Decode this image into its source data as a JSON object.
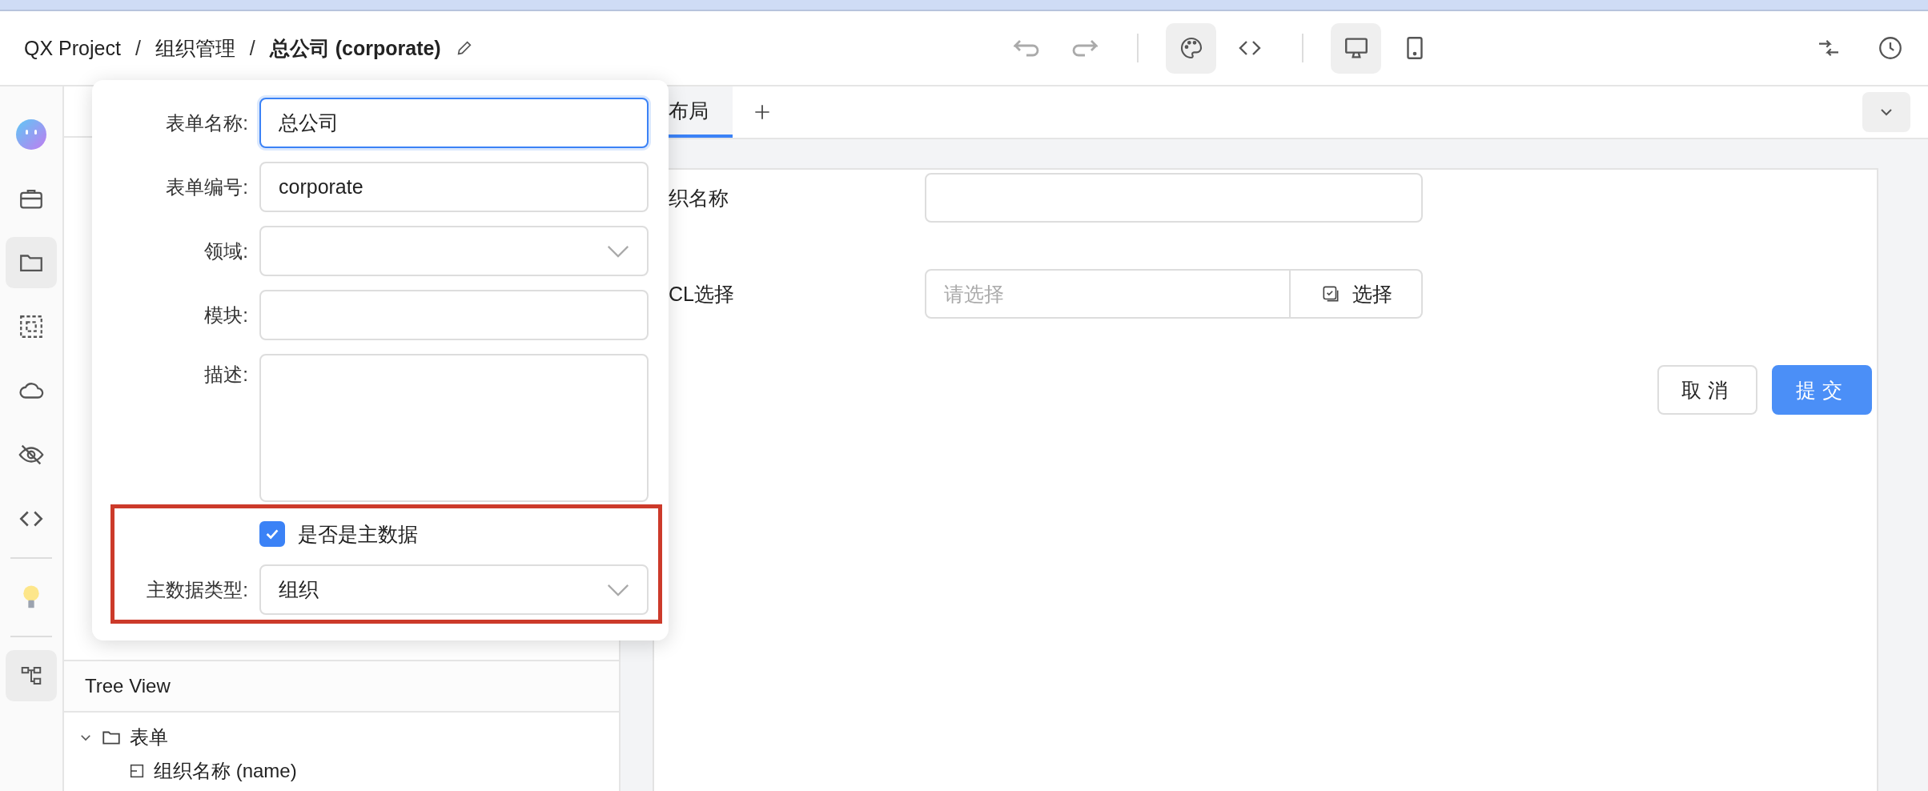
{
  "breadcrumb": {
    "items": [
      "QX Project",
      "组织管理"
    ],
    "separator": "/",
    "current": "总公司 (corporate)"
  },
  "toolbar": {
    "history": [
      {
        "kind": "undo",
        "disabled": true
      },
      {
        "kind": "redo",
        "disabled": true
      }
    ],
    "views": [
      {
        "kind": "palette",
        "selected": true
      },
      {
        "kind": "code",
        "selected": false
      }
    ],
    "devices": [
      {
        "kind": "desktop",
        "selected": true
      },
      {
        "kind": "tablet",
        "selected": false
      }
    ]
  },
  "rail": [
    {
      "kind": "avatar",
      "selected": false
    },
    {
      "kind": "briefcase",
      "selected": false
    },
    {
      "kind": "folder",
      "selected": true
    },
    {
      "kind": "select",
      "selected": false
    },
    {
      "kind": "cloud",
      "selected": false
    },
    {
      "kind": "eye-off",
      "selected": false
    },
    {
      "kind": "code",
      "selected": false
    },
    {
      "kind": "bulb",
      "selected": false
    },
    {
      "kind": "tree",
      "selected": true
    }
  ],
  "tabs": [
    {
      "label": "布局",
      "selected": true
    }
  ],
  "form": {
    "fields": [
      {
        "label": "织名称",
        "kind": "input"
      },
      {
        "label": "CL选择",
        "kind": "picker",
        "placeholder": "请选择",
        "button": "选择"
      }
    ],
    "buttons": [
      {
        "label": "取消",
        "kind": "default"
      },
      {
        "label": "提交",
        "kind": "primary"
      }
    ]
  },
  "popup": {
    "fields": [
      {
        "label": "表单名称:",
        "kind": "input",
        "value": "总公司",
        "focused": true
      },
      {
        "label": "表单编号:",
        "kind": "input",
        "value": "corporate",
        "focused": false
      },
      {
        "label": "领域:",
        "kind": "select"
      },
      {
        "label": "模块:",
        "kind": "input",
        "focused": false
      },
      {
        "label": "描述:",
        "kind": "textarea"
      }
    ],
    "master_data": {
      "highlighted": true,
      "checkbox_label": "是否是主数据",
      "checked": true,
      "type_label": "主数据类型:",
      "type_value": "组织"
    }
  },
  "tree_view": {
    "title": "Tree View",
    "items": [
      {
        "label": "表单",
        "expanded": true,
        "children": [
          {
            "label": "组织名称 (name)"
          }
        ]
      }
    ]
  }
}
